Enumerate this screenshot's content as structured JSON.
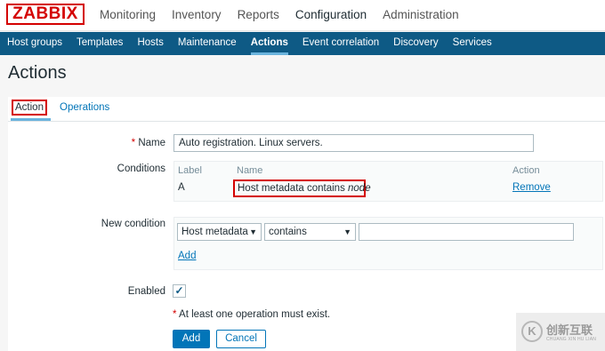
{
  "app": {
    "logo": "ZABBIX"
  },
  "top_menu": [
    "Monitoring",
    "Inventory",
    "Reports",
    "Configuration",
    "Administration"
  ],
  "top_menu_active": "Configuration",
  "sub_menu": [
    "Host groups",
    "Templates",
    "Hosts",
    "Maintenance",
    "Actions",
    "Event correlation",
    "Discovery",
    "Services"
  ],
  "sub_menu_active": "Actions",
  "page": {
    "title": "Actions"
  },
  "tabs": {
    "action": "Action",
    "operations": "Operations"
  },
  "form": {
    "name_label": "Name",
    "name_required": "*",
    "name_value": "Auto registration. Linux servers.",
    "conditions_label": "Conditions",
    "conditions_table": {
      "headers": {
        "label": "Label",
        "name": "Name",
        "action": "Action"
      },
      "rows": [
        {
          "label": "A",
          "name_prefix": "Host metadata contains ",
          "name_value": "node",
          "action": "Remove"
        }
      ]
    },
    "new_condition_label": "New condition",
    "new_condition": {
      "type_value": "Host metadata",
      "operator_value": "contains",
      "value": "",
      "add_label": "Add"
    },
    "enabled_label": "Enabled",
    "enabled_checked": true,
    "check_mark": "✓",
    "warning": "At least one operation must exist.",
    "warning_mark": "*",
    "add_button": "Add",
    "cancel_button": "Cancel"
  },
  "watermark": {
    "logo": "K",
    "text": "创新互联",
    "sub": "CHUANG XIN HU LIAN"
  },
  "colors": {
    "brand_red": "#d40000",
    "nav_blue": "#0e5a85",
    "link_blue": "#0275b8"
  }
}
